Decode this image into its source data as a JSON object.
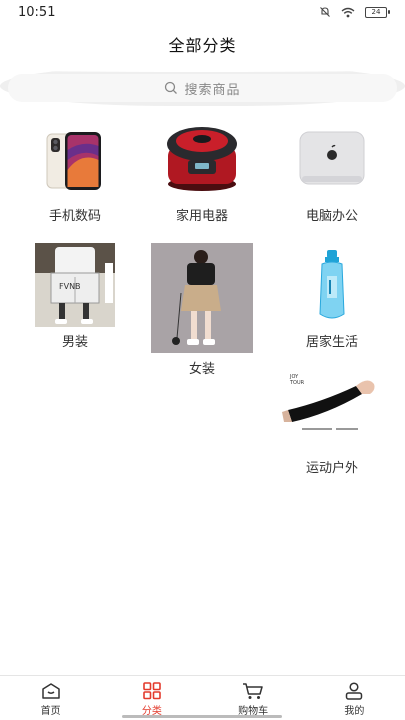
{
  "status": {
    "time": "10:51",
    "battery": "24"
  },
  "header": {
    "title": "全部分类"
  },
  "search": {
    "placeholder": "搜索商品"
  },
  "categories": [
    {
      "label": "手机数码"
    },
    {
      "label": "家用电器"
    },
    {
      "label": "电脑办公"
    },
    {
      "label": "男装"
    },
    {
      "label": "女装"
    },
    {
      "label": "居家生活"
    },
    {
      "label": "运动户外"
    }
  ],
  "tabs": [
    {
      "label": "首页",
      "icon": "home-icon",
      "active": false
    },
    {
      "label": "分类",
      "icon": "category-grid-icon",
      "active": true
    },
    {
      "label": "购物车",
      "icon": "cart-icon",
      "active": false
    },
    {
      "label": "我的",
      "icon": "user-icon",
      "active": false
    }
  ],
  "colors": {
    "accent": "#e33a2c",
    "search_bg": "#efefef"
  }
}
